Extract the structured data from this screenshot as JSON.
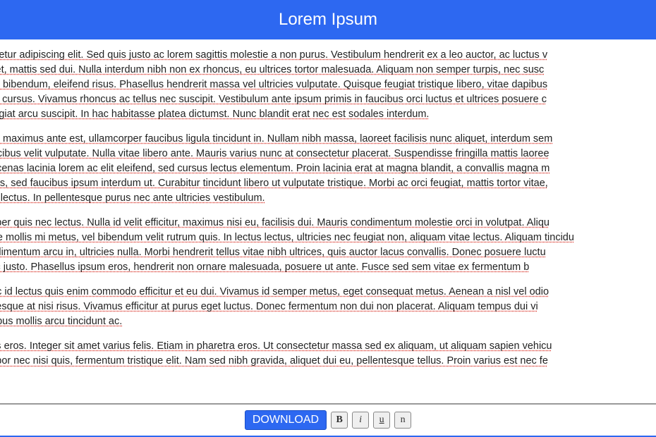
{
  "header": {
    "title": "Lorem Ipsum"
  },
  "paragraphs": [
    "t amet, consectetur adipiscing elit. Sed quis justo ac lorem sagittis molestie a non purus. Vestibulum hendrerit ex a leo auctor, ac luctus v\nporta posuere et, mattis sed dui. Nulla interdum nibh non ex rhoncus, eu ultrices tortor malesuada. Aliquam non semper turpis, nec susc\n, hendrerit justo bibendum, eleifend risus. Phasellus hendrerit massa vel ultricies vulputate. Quisque feugiat tristique libero, vitae dapibus\nmauris rhoncus cursus. Vivamus rhoncus ac tellus nec suscipit. Vestibulum ante ipsum primis in faucibus orci luctus et ultrices posuere c\ndictum, nec feugiat arcu suscipit. In hac habitasse platea dictumst. Nunc blandit erat nec est sodales interdum.",
    "a. Pellentesque maximus ante est, ullamcorper faucibus ligula tincidunt in. Nullam nibh massa, laoreet facilisis nunc aliquet, interdum sem\nemper, sed faucibus velit vulputate. Nulla vitae libero ante. Mauris varius nunc at consectetur placerat. Suspendisse fringilla mattis laoree\nelerisque. Maecenas lacinia lorem ac elit eleifend, sed cursus lectus elementum. Proin lacinia erat at magna blandit, a convallis magna m\natis ipsum lectus, sed faucibus ipsum interdum ut. Curabitur tincidunt libero ut vulputate tristique. Morbi ac orci feugiat, mattis tortor vitae,\ne, sed vehicula lectus. In pellentesque purus nec ante ultricies vestibulum.",
    "s rhoncus semper quis nec lectus. Nulla id velit efficitur, maximus nisi eu, facilisis dui. Mauris condimentum molestie orci in volutpat. Aliqu\nat. Pellentesque mollis mi metus, vel bibendum velit rutrum quis. In lectus lectus, ultricies nec feugiat non, aliquam vitae lectus. Aliquam tincidu\nis congue, condimentum arcu in, ultricies nulla. Morbi hendrerit tellus vitae nibh ultrices, quis auctor lacus convallis. Donec posuere luctu\neu, ultricies nec justo. Phasellus ipsum eros, hendrerit non ornare malesuada, posuere ut ante. Fusce sed sem vitae ex fermentum b",
    "n neque. Donec id lectus quis enim commodo efficitur et eu dui. Vivamus id semper metus, eget consequat metus. Aenean a nisl vel odio\neu nisl. Pellentesque at nisi risus. Vivamus efficitur at purus eget luctus. Donec fermentum non dui non placerat. Aliquam tempus dui vi\nerdiet est, dapibus mollis arcu tincidunt ac.",
    "acus, ut facilisis eros. Integer sit amet varius felis. Etiam in pharetra eros. Ut consectetur massa sed ex aliquam, ut aliquam sapien vehicu\nodio risus, tempor nec nisi quis, fermentum tristique elit. Nam sed nibh gravida, aliquet dui eu, pellentesque tellus. Proin varius est nec fe"
  ],
  "toolbar": {
    "download_label": "DOWNLOAD",
    "bold_label": "B",
    "italic_label": "i",
    "underline_label": "u",
    "normal_label": "n"
  }
}
